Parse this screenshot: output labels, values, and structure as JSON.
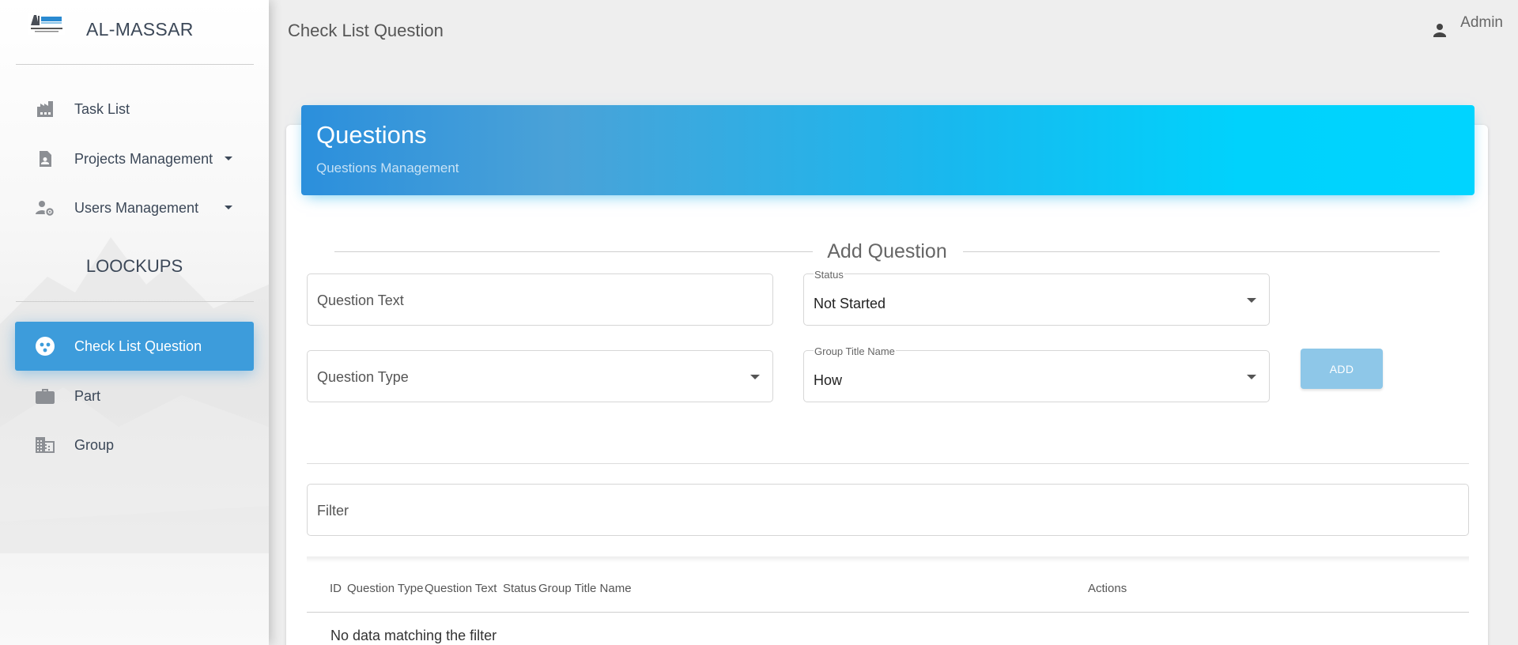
{
  "brand": {
    "name": "AL-MASSAR"
  },
  "sidebar": {
    "items": [
      {
        "label": "Task List",
        "icon": "factory-icon"
      },
      {
        "label": "Projects Management",
        "icon": "assignment-ind-icon"
      },
      {
        "label": "Users Management",
        "icon": "manage-accounts-icon"
      }
    ],
    "section_title": "LOOCKUPS",
    "lookups": [
      {
        "label": "Check List Question",
        "icon": "group-work-icon",
        "active": true
      },
      {
        "label": "Part",
        "icon": "work-icon"
      },
      {
        "label": "Group",
        "icon": "domain-icon"
      }
    ]
  },
  "topbar": {
    "page_title": "Check List Question",
    "user_name": "Admin"
  },
  "card": {
    "title": "Questions",
    "subtitle": "Questions Management",
    "header_gradient": [
      "#2b8fdc",
      "#00d4ff"
    ]
  },
  "form": {
    "legend": "Add Question",
    "question_text_placeholder": "Question Text",
    "status_label": "Status",
    "status_value": "Not Started",
    "question_type_placeholder": "Question Type",
    "group_title_label": "Group Title Name",
    "group_title_value": "How",
    "add_label": "ADD"
  },
  "filter": {
    "placeholder": "Filter"
  },
  "table": {
    "columns": [
      "ID",
      "Question Type",
      "Question Text",
      "Status",
      "Group Title Name",
      "Actions"
    ],
    "empty_text": "No data matching the filter"
  },
  "colors": {
    "active_nav": "#3d9cdb",
    "add_button": "#8ec7e8"
  }
}
